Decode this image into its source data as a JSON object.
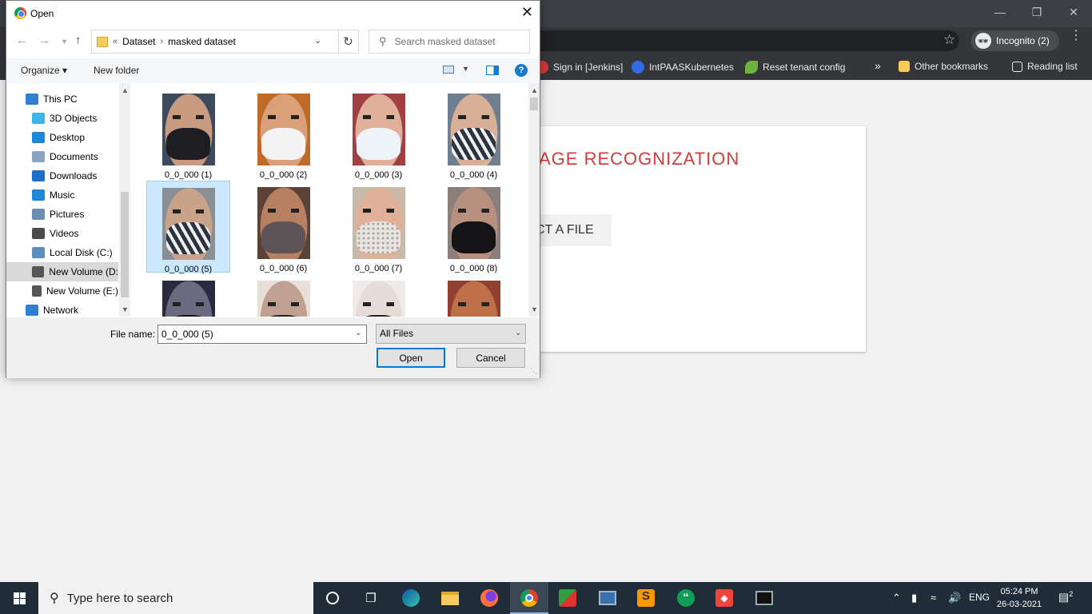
{
  "browser": {
    "incognito_label": "Incognito (2)",
    "bookmarks": [
      {
        "label": "Sign in [Jenkins]",
        "icon": "jenkins-icon",
        "color": "#d33833"
      },
      {
        "label": "IntPAASKubernetes",
        "icon": "kubernetes-icon",
        "color": "#326ce5"
      },
      {
        "label": "Reset tenant config",
        "icon": "leaf-icon",
        "color": "#6db33f"
      }
    ],
    "overflow_label": "»",
    "other_bookmarks": "Other bookmarks",
    "reading_list": "Reading list"
  },
  "page": {
    "heading_visible": "AGE RECOGNIZATION",
    "select_button_visible": "CT A FILE",
    "heading_color": "#d33a3a"
  },
  "dialog": {
    "title": "Open",
    "breadcrumb": {
      "prefix": "«",
      "parts": [
        "Dataset",
        "masked dataset"
      ],
      "separator": "›"
    },
    "search_placeholder": "Search masked dataset",
    "organize": "Organize ▾",
    "new_folder": "New folder",
    "help_glyph": "?",
    "nav_items": [
      {
        "label": "This PC",
        "icon": "this-pc-icon",
        "color": "#2f7fd2"
      },
      {
        "label": "3D Objects",
        "icon": "3d-objects-icon",
        "color": "#3fb3e8"
      },
      {
        "label": "Desktop",
        "icon": "desktop-icon",
        "color": "#1e88d8"
      },
      {
        "label": "Documents",
        "icon": "documents-icon",
        "color": "#8aa3bf"
      },
      {
        "label": "Downloads",
        "icon": "downloads-icon",
        "color": "#1e6fc9"
      },
      {
        "label": "Music",
        "icon": "music-icon",
        "color": "#1e88d8"
      },
      {
        "label": "Pictures",
        "icon": "pictures-icon",
        "color": "#6b8fb3"
      },
      {
        "label": "Videos",
        "icon": "videos-icon",
        "color": "#4b4b4b"
      },
      {
        "label": "Local Disk (C:)",
        "icon": "local-disk-icon",
        "color": "#5c8fbf"
      },
      {
        "label": "New Volume (D:",
        "icon": "drive-icon",
        "color": "#555"
      },
      {
        "label": "New Volume (E:)",
        "icon": "drive-icon",
        "color": "#555"
      },
      {
        "label": "Network",
        "icon": "network-icon",
        "color": "#2f7fd2"
      }
    ],
    "selected_nav_index": 9,
    "files": [
      {
        "name": "0_0_000 (1)",
        "skin": "#c89a80",
        "bg": "#3b4a5c",
        "mask": "#1e1e22",
        "pattern": "none"
      },
      {
        "name": "0_0_000 (2)",
        "skin": "#d9a07a",
        "bg": "#c06a2a",
        "mask": "#f4f4f4",
        "pattern": "none"
      },
      {
        "name": "0_0_000 (3)",
        "skin": "#e0b09a",
        "bg": "#a04040",
        "mask": "#eef3f8",
        "pattern": "none"
      },
      {
        "name": "0_0_000 (4)",
        "skin": "#d8b098",
        "bg": "#6f7f8f",
        "mask": "#2a3340",
        "pattern": "triangles"
      },
      {
        "name": "0_0_000 (5)",
        "skin": "#c9a28a",
        "bg": "#8a8f96",
        "mask": "#2b3440",
        "pattern": "triangles"
      },
      {
        "name": "0_0_000 (6)",
        "skin": "#b88062",
        "bg": "#5a4236",
        "mask": "#5c5456",
        "pattern": "none"
      },
      {
        "name": "0_0_000 (7)",
        "skin": "#e0b098",
        "bg": "#c9b9a9",
        "mask": "#e8e4e0",
        "pattern": "dots"
      },
      {
        "name": "0_0_000 (8)",
        "skin": "#b89080",
        "bg": "#8a7f7a",
        "mask": "#141416",
        "pattern": "none"
      },
      {
        "name": "",
        "skin": "#6a6a80",
        "bg": "#2a2a40",
        "mask": "#101018",
        "pattern": "none"
      },
      {
        "name": "",
        "skin": "#c0a090",
        "bg": "#e8e0d8",
        "mask": "#202020",
        "pattern": "none"
      },
      {
        "name": "",
        "skin": "#e8dcd8",
        "bg": "#f0eae8",
        "mask": "#222",
        "pattern": "none"
      },
      {
        "name": "",
        "skin": "#c07048",
        "bg": "#904030",
        "mask": "#c07048",
        "pattern": "none"
      }
    ],
    "selected_file_index": 4,
    "filename_label": "File name:",
    "filename_value": "0_0_000 (5)",
    "filetype": "All Files",
    "open_button": "Open",
    "cancel_button": "Cancel"
  },
  "taskbar": {
    "search_placeholder": "Type here to search",
    "language": "ENG",
    "time": "05:24 PM",
    "date": "26-03-2021",
    "notification_count": "2"
  },
  "colors": {
    "selection_bg": "#cce8ff",
    "accent": "#0078d7",
    "taskbar_bg": "#202c38"
  }
}
